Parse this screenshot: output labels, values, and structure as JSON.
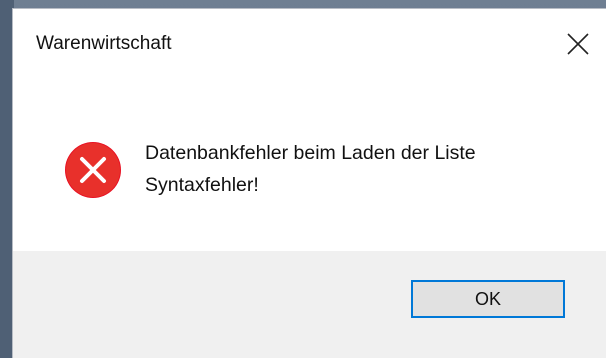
{
  "window": {
    "title": "Warenwirtschaft",
    "close_icon": "close-icon"
  },
  "message": {
    "icon": "error-icon",
    "line1": "Datenbankfehler beim Laden der Liste",
    "line2": "Syntaxfehler!"
  },
  "buttons": {
    "ok_label": "OK"
  },
  "colors": {
    "error_red": "#e81123",
    "focus_border": "#0078d7",
    "footer_bg": "#f0f0f0"
  }
}
